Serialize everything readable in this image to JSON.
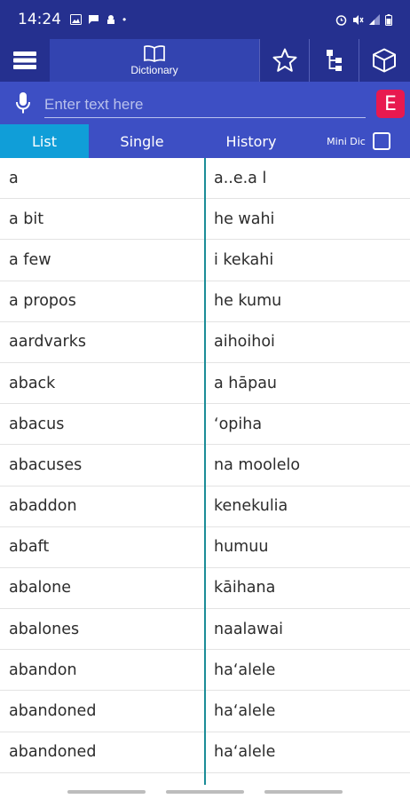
{
  "status_bar": {
    "time": "14:24",
    "dot": "•"
  },
  "toolbar": {
    "dictionary_label": "Dictionary"
  },
  "search": {
    "placeholder": "Enter text here",
    "lang_button": "E"
  },
  "tabs": {
    "list": "List",
    "single": "Single",
    "history": "History",
    "mini_dic": "Mini Dic"
  },
  "entries": [
    {
      "en": "a",
      "haw": "a..e.a l"
    },
    {
      "en": "a bit",
      "haw": "he wahi"
    },
    {
      "en": "a few",
      "haw": "i kekahi"
    },
    {
      "en": "a propos",
      "haw": "he kumu"
    },
    {
      "en": "aardvarks",
      "haw": "aihoihoi"
    },
    {
      "en": "aback",
      "haw": "a hāpau"
    },
    {
      "en": "abacus",
      "haw": "ʻopiha"
    },
    {
      "en": "abacuses",
      "haw": "na moolelo"
    },
    {
      "en": "abaddon",
      "haw": "kenekulia"
    },
    {
      "en": "abaft",
      "haw": "humuu"
    },
    {
      "en": "abalone",
      "haw": "kāihana"
    },
    {
      "en": "abalones",
      "haw": "naalawai"
    },
    {
      "en": "abandon",
      "haw": "haʻalele"
    },
    {
      "en": "abandoned",
      "haw": "haʻalele"
    },
    {
      "en": "abandoned",
      "haw": "haʻalele"
    }
  ],
  "colors": {
    "status_bg": "#25308f",
    "toolbar_bg": "#25308f",
    "search_bg": "#3d4fc4",
    "active_tab": "#109ed8",
    "lang_button": "#e8194f",
    "divider": "#1b8c97"
  },
  "icons": {
    "menu": "menu-icon",
    "dictionary": "book-icon",
    "favorites": "star-icon",
    "tree": "tree-icon",
    "box": "cube-icon",
    "mic": "microphone-icon"
  }
}
